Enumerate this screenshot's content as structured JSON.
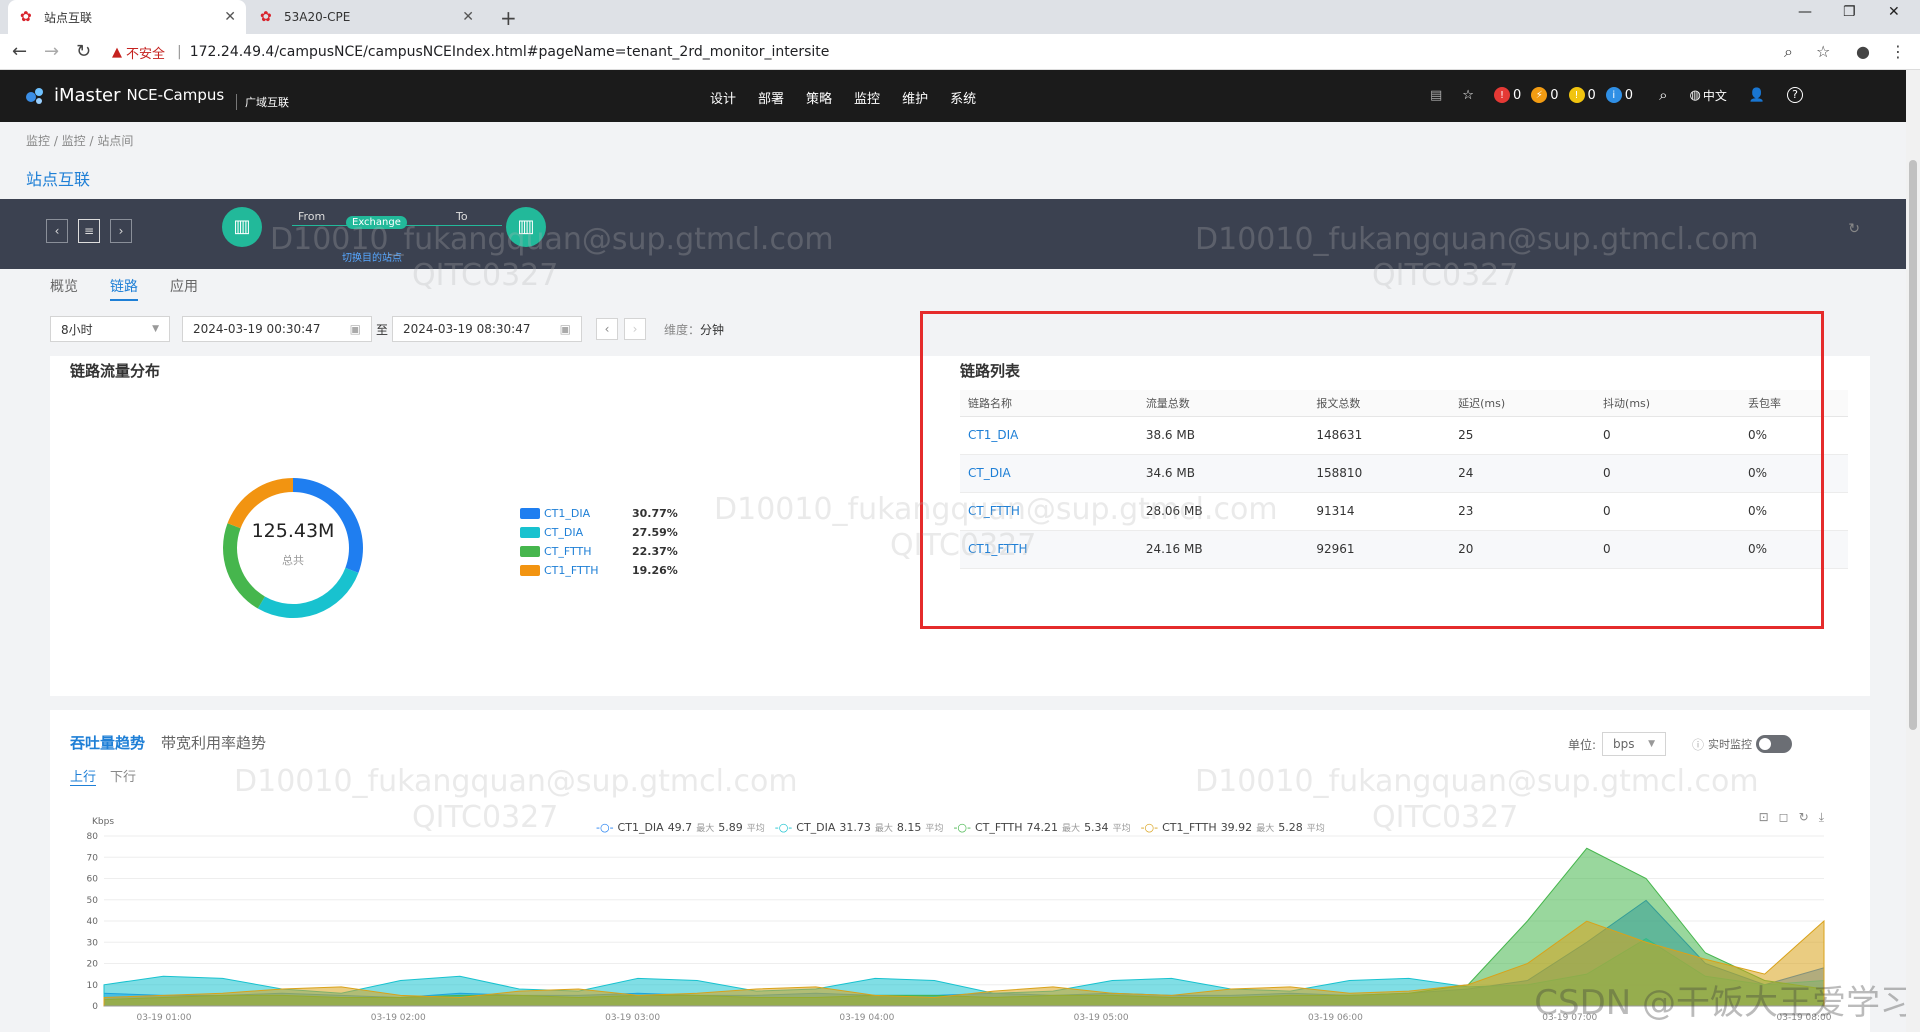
{
  "browser": {
    "tabs": [
      {
        "title": "站点互联",
        "active": true
      },
      {
        "title": "53A20-CPE",
        "active": false
      }
    ],
    "not_secure": "不安全",
    "url": "172.24.49.4/campusNCE/campusNCEIndex.html#pageName=tenant_2rd_monitor_intersite"
  },
  "app": {
    "logo_main": "iMaster",
    "logo_sub": "NCE-Campus",
    "tenant": "广域互联",
    "menu": [
      "设计",
      "部署",
      "策略",
      "监控",
      "维护",
      "系统"
    ],
    "alarms": {
      "critical": "0",
      "major": "0",
      "minor": "0",
      "info": "0"
    },
    "lang": "中文",
    "colors": {
      "critical": "#e53935",
      "major": "#f39c12",
      "minor": "#f1c40f",
      "info": "#2f8fe5"
    }
  },
  "breadcrumb": "监控 / 监控 / 站点间",
  "page_title": "站点互联",
  "topology": {
    "from": "From",
    "to": "To",
    "exchange": "Exchange",
    "switch_link": "切换目的站点"
  },
  "subtabs": [
    "概览",
    "链路",
    "应用"
  ],
  "filters": {
    "range": "8小时",
    "start": "2024-03-19 00:30:47",
    "to_sep": "至",
    "end": "2024-03-19 08:30:47",
    "dimension_label": "维度：",
    "dimension_value": "分钟"
  },
  "distribution": {
    "title": "链路流量分布",
    "total_value": "125.43M",
    "total_label": "总共",
    "items": [
      {
        "name": "CT1_DIA",
        "pct": "30.77%",
        "color": "#1f7ef0"
      },
      {
        "name": "CT_DIA",
        "pct": "27.59%",
        "color": "#18c2cf"
      },
      {
        "name": "CT_FTTH",
        "pct": "22.37%",
        "color": "#46b64d"
      },
      {
        "name": "CT1_FTTH",
        "pct": "19.26%",
        "color": "#f29411"
      }
    ]
  },
  "link_list": {
    "title": "链路列表",
    "columns": [
      "链路名称",
      "流量总数",
      "报文总数",
      "延迟(ms)",
      "抖动(ms)",
      "丢包率"
    ],
    "rows": [
      [
        "CT1_DIA",
        "38.6 MB",
        "148631",
        "25",
        "0",
        "0%"
      ],
      [
        "CT_DIA",
        "34.6 MB",
        "158810",
        "24",
        "0",
        "0%"
      ],
      [
        "CT_FTTH",
        "28.06 MB",
        "91314",
        "23",
        "0",
        "0%"
      ],
      [
        "CT1_FTTH",
        "24.16 MB",
        "92961",
        "20",
        "0",
        "0%"
      ]
    ]
  },
  "trend": {
    "tabs": [
      "吞吐量趋势",
      "带宽利用率趋势"
    ],
    "directions": [
      "上行",
      "下行"
    ],
    "unit_label": "单位:",
    "unit_value": "bps",
    "realtime_label": "实时监控",
    "legend": [
      {
        "name": "CT1_DIA",
        "max": "49.7",
        "avg": "5.89",
        "color": "#1f7ef0"
      },
      {
        "name": "CT_DIA",
        "max": "31.73",
        "avg": "8.15",
        "color": "#18c2cf"
      },
      {
        "name": "CT_FTTH",
        "max": "74.21",
        "avg": "5.34",
        "color": "#46b64d"
      },
      {
        "name": "CT1_FTTH",
        "max": "39.92",
        "avg": "5.28",
        "color": "#d9a21a"
      }
    ],
    "max_word": "最大",
    "avg_word": "平均"
  },
  "chart_data": {
    "type": "area",
    "ylabel": "Kbps",
    "ylim": [
      0,
      80
    ],
    "yticks": [
      "80",
      "70",
      "60",
      "50",
      "40",
      "30",
      "20",
      "10",
      "0"
    ],
    "xticks": [
      "03-19 01:00",
      "03-19 02:00",
      "03-19 03:00",
      "03-19 04:00",
      "03-19 05:00",
      "03-19 06:00",
      "03-19 07:00",
      "03-19 08:00"
    ],
    "series": [
      {
        "name": "CT1_DIA",
        "color": "#1f7ef0",
        "values": [
          6,
          5,
          5,
          6,
          5,
          4,
          6,
          5,
          5,
          6,
          5,
          5,
          6,
          5,
          5,
          6,
          5,
          6,
          5,
          5,
          6,
          5,
          6,
          8,
          12,
          30,
          49.7,
          20,
          10,
          18
        ]
      },
      {
        "name": "CT_DIA",
        "color": "#18c2cf",
        "values": [
          10,
          14,
          13,
          8,
          6,
          12,
          14,
          8,
          7,
          13,
          12,
          7,
          8,
          13,
          12,
          6,
          7,
          12,
          13,
          8,
          7,
          12,
          13,
          9,
          10,
          15,
          31.73,
          14,
          10,
          12
        ]
      },
      {
        "name": "CT_FTTH",
        "color": "#46b64d",
        "values": [
          3,
          4,
          5,
          5,
          4,
          4,
          5,
          5,
          4,
          5,
          5,
          4,
          4,
          5,
          5,
          4,
          5,
          5,
          4,
          4,
          5,
          5,
          6,
          10,
          40,
          74.21,
          60,
          25,
          12,
          8
        ]
      },
      {
        "name": "CT1_FTTH",
        "color": "#d9a21a",
        "values": [
          4,
          5,
          6,
          8,
          9,
          5,
          4,
          7,
          8,
          5,
          6,
          8,
          9,
          5,
          4,
          7,
          9,
          6,
          5,
          8,
          9,
          6,
          7,
          10,
          20,
          39.92,
          30,
          22,
          15,
          40
        ]
      }
    ]
  },
  "watermarks": {
    "user": "D10010_fukangquan@sup.gtmcl.com",
    "code": "QITC0327",
    "csdn": "CSDN @干饭大王爱学习"
  }
}
